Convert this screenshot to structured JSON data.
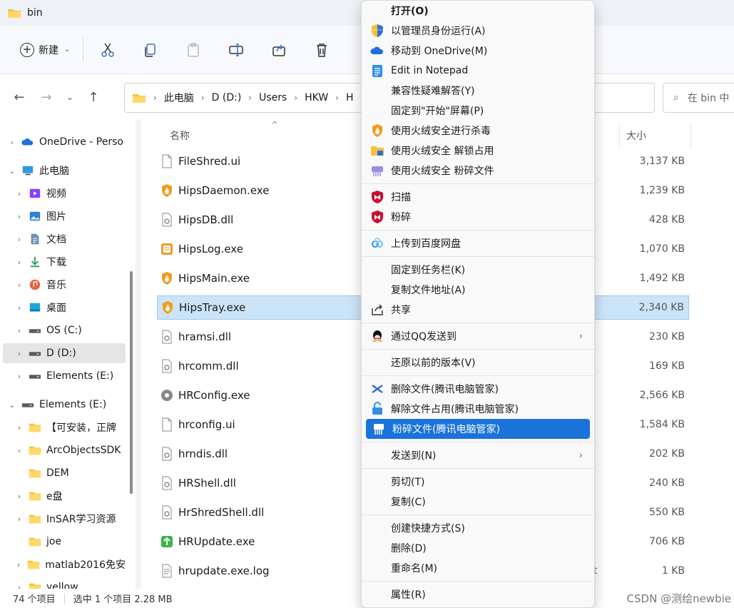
{
  "window": {
    "title": "bin"
  },
  "toolbar": {
    "new_label": "新建"
  },
  "address": {
    "crumbs": [
      "此电脑",
      "D (D:)",
      "Users",
      "HKW",
      "H"
    ],
    "search_placeholder": "在 bin 中"
  },
  "sidebar": {
    "items": [
      {
        "label": "OneDrive - Perso",
        "icon": "onedrive-icon",
        "level": 0,
        "expander": "›"
      },
      {
        "label": "此电脑",
        "icon": "pc-icon",
        "level": 0,
        "expander": "⌄"
      },
      {
        "label": "视频",
        "icon": "video-icon",
        "level": 1,
        "expander": "›"
      },
      {
        "label": "图片",
        "icon": "pictures-icon",
        "level": 1,
        "expander": "›"
      },
      {
        "label": "文档",
        "icon": "documents-icon",
        "level": 1,
        "expander": "›"
      },
      {
        "label": "下载",
        "icon": "download-icon",
        "level": 1,
        "expander": "›"
      },
      {
        "label": "音乐",
        "icon": "music-icon",
        "level": 1,
        "expander": "›"
      },
      {
        "label": "桌面",
        "icon": "desktop-icon",
        "level": 1,
        "expander": "›"
      },
      {
        "label": "OS (C:)",
        "icon": "drive-icon",
        "level": 1,
        "expander": "›"
      },
      {
        "label": "D (D:)",
        "icon": "drive-icon",
        "level": 1,
        "expander": "›",
        "selected": true
      },
      {
        "label": "Elements (E:)",
        "icon": "drive-icon",
        "level": 1,
        "expander": "›"
      },
      {
        "label": "Elements (E:)",
        "icon": "drive-icon",
        "level": 0,
        "expander": "⌄"
      },
      {
        "label": "【可安装，正牌",
        "icon": "folder-icon",
        "level": 1,
        "expander": "›"
      },
      {
        "label": "ArcObjectsSDK",
        "icon": "folder-icon",
        "level": 1,
        "expander": "›"
      },
      {
        "label": "DEM",
        "icon": "folder-icon",
        "level": 1,
        "expander": ""
      },
      {
        "label": "e盘",
        "icon": "folder-icon",
        "level": 1,
        "expander": "›"
      },
      {
        "label": "InSAR学习资源",
        "icon": "folder-icon",
        "level": 1,
        "expander": "›"
      },
      {
        "label": "joe",
        "icon": "folder-icon",
        "level": 1,
        "expander": ""
      },
      {
        "label": "matlab2016免安",
        "icon": "folder-icon",
        "level": 1,
        "expander": "›"
      },
      {
        "label": "yellow",
        "icon": "folder-icon",
        "level": 1,
        "expander": "›"
      }
    ]
  },
  "filelist": {
    "columns": {
      "name": "名称",
      "size": "大小"
    },
    "files": [
      {
        "name": "FileShred.ui",
        "size": "3,137 KB",
        "icon": "document-file-icon"
      },
      {
        "name": "HipsDaemon.exe",
        "size": "1,239 KB",
        "icon": "huorong-shield-icon"
      },
      {
        "name": "HipsDB.dll",
        "size": "428 KB",
        "icon": "dll-file-icon"
      },
      {
        "name": "HipsLog.exe",
        "size": "1,070 KB",
        "icon": "log-app-icon"
      },
      {
        "name": "HipsMain.exe",
        "size": "1,492 KB",
        "icon": "huorong-shield-icon"
      },
      {
        "name": "HipsTray.exe",
        "size": "2,340 KB",
        "icon": "huorong-shield-icon",
        "selected": true
      },
      {
        "name": "hramsi.dll",
        "size": "230 KB",
        "icon": "dll-file-icon"
      },
      {
        "name": "hrcomm.dll",
        "size": "169 KB",
        "icon": "dll-file-icon"
      },
      {
        "name": "HRConfig.exe",
        "size": "2,566 KB",
        "icon": "gear-app-icon"
      },
      {
        "name": "hrconfig.ui",
        "size": "1,584 KB",
        "icon": "document-file-icon"
      },
      {
        "name": "hrndis.dll",
        "size": "202 KB",
        "icon": "dll-file-icon"
      },
      {
        "name": "HRShell.dll",
        "size": "240 KB",
        "icon": "dll-file-icon"
      },
      {
        "name": "HrShredShell.dll",
        "size": "550 KB",
        "icon": "dll-file-icon"
      },
      {
        "name": "HRUpdate.exe",
        "size": "706 KB",
        "icon": "update-app-icon"
      },
      {
        "name": "hrupdate.exe.log",
        "size": "1 KB",
        "icon": "text-file-icon",
        "extra": "t"
      }
    ]
  },
  "status": {
    "count": "74 个项目",
    "selection": "选中 1 个项目  2.28 MB"
  },
  "watermark": "CSDN @测绘newbie",
  "context_menu": {
    "items": [
      {
        "label": "打开(O)",
        "bold": true,
        "icon": ""
      },
      {
        "label": "以管理员身份运行(A)",
        "icon": "uac-shield-icon"
      },
      {
        "label": "移动到 OneDrive(M)",
        "icon": "onedrive-icon"
      },
      {
        "label": "Edit in Notepad",
        "icon": "notepad-icon"
      },
      {
        "label": "兼容性疑难解答(Y)",
        "icon": ""
      },
      {
        "label": "固定到\"开始\"屏幕(P)",
        "icon": ""
      },
      {
        "label": "使用火绒安全进行杀毒",
        "icon": "huorong-shield-icon"
      },
      {
        "label": "使用火绒安全 解锁占用",
        "icon": "unlock-folder-icon"
      },
      {
        "label": "使用火绒安全 粉碎文件",
        "icon": "shredder-icon"
      },
      {
        "sep": true
      },
      {
        "label": "扫描",
        "icon": "mcafee-icon"
      },
      {
        "label": "粉碎",
        "icon": "mcafee-icon"
      },
      {
        "sep": true
      },
      {
        "label": "上传到百度网盘",
        "icon": "baidu-netdisk-icon"
      },
      {
        "sep": true
      },
      {
        "label": "固定到任务栏(K)",
        "icon": ""
      },
      {
        "label": "复制文件地址(A)",
        "icon": ""
      },
      {
        "label": "共享",
        "icon": "share-icon"
      },
      {
        "sep": true
      },
      {
        "label": "通过QQ发送到",
        "icon": "qq-icon",
        "submenu": true
      },
      {
        "sep": true
      },
      {
        "label": "还原以前的版本(V)",
        "icon": ""
      },
      {
        "sep": true
      },
      {
        "label": "删除文件(腾讯电脑管家)",
        "icon": "tencent-delete-icon"
      },
      {
        "label": "解除文件占用(腾讯电脑管家)",
        "icon": "tencent-unlock-icon"
      },
      {
        "label": "粉碎文件(腾讯电脑管家)",
        "icon": "tencent-shred-icon",
        "highlighted": true
      },
      {
        "sep": true
      },
      {
        "label": "发送到(N)",
        "icon": "",
        "submenu": true
      },
      {
        "sep": true
      },
      {
        "label": "剪切(T)",
        "icon": ""
      },
      {
        "label": "复制(C)",
        "icon": ""
      },
      {
        "sep": true
      },
      {
        "label": "创建快捷方式(S)",
        "icon": ""
      },
      {
        "label": "删除(D)",
        "icon": ""
      },
      {
        "label": "重命名(M)",
        "icon": ""
      },
      {
        "sep": true
      },
      {
        "label": "属性(R)",
        "icon": ""
      }
    ]
  },
  "colors": {
    "accent": "#1a73d9",
    "selection": "#cce4f7",
    "folder": "#f5c242"
  }
}
